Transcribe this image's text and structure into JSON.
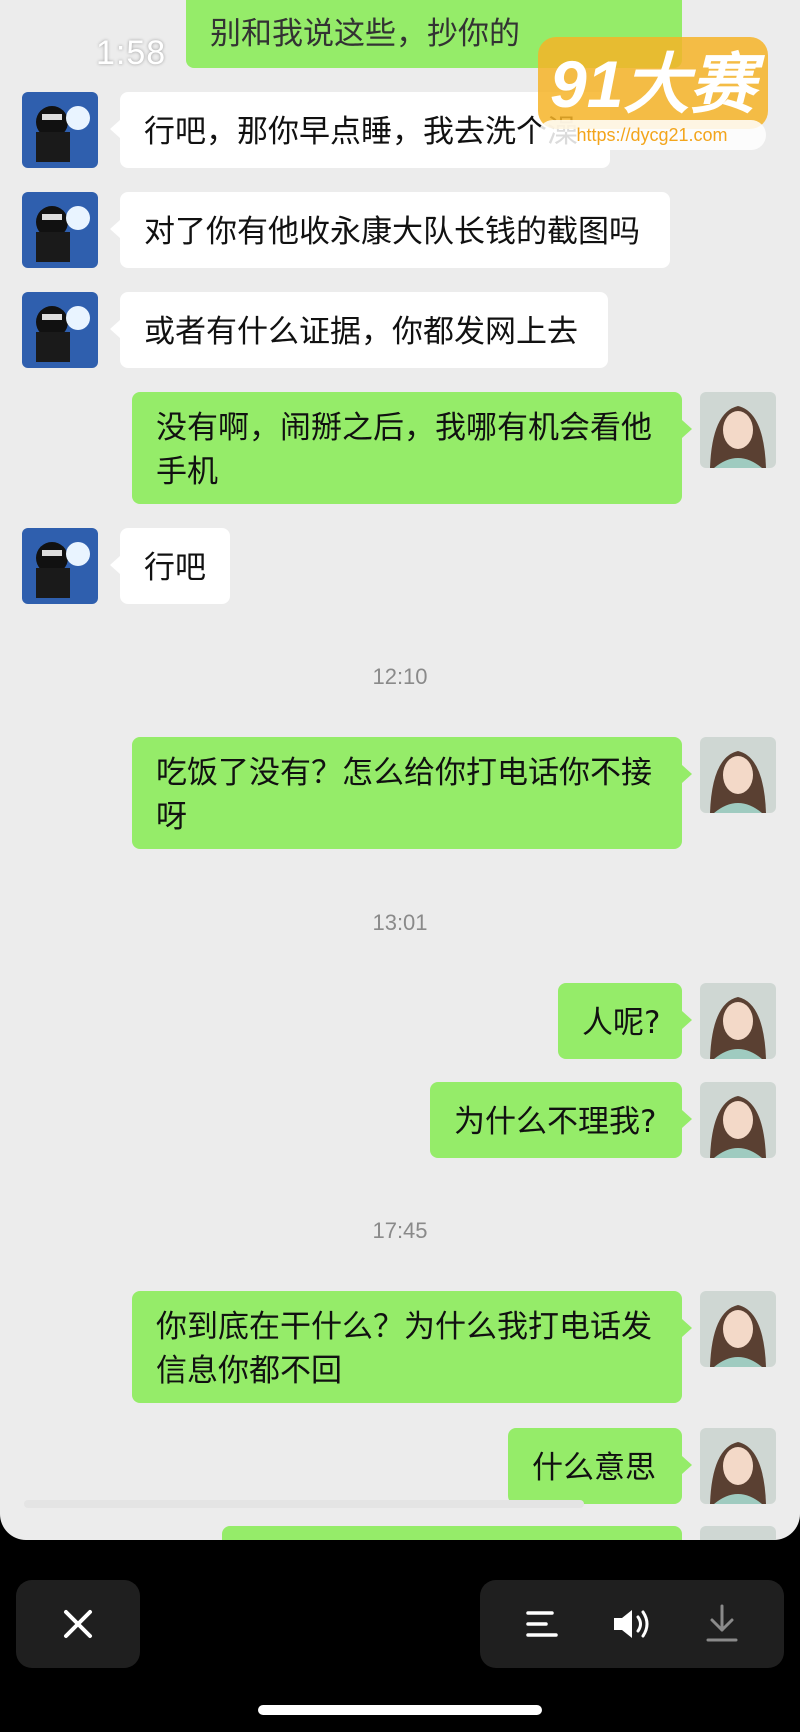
{
  "status": {
    "time": "1:58"
  },
  "watermark": {
    "text": "91大赛",
    "url": "https://dycg21.com"
  },
  "messages": {
    "top_partial": "别和我说这些，抄你的",
    "m1": "行吧，那你早点睡，我去洗个澡",
    "m2": "对了你有他收永康大队长钱的截图吗",
    "m3": "或者有什么证据，你都发网上去",
    "m4": "没有啊，闹掰之后，我哪有机会看他手机",
    "m5": "行吧",
    "ts1": "12:10",
    "m6": "吃饭了没有？怎么给你打电话你不接呀",
    "ts2": "13:01",
    "m7": "人呢?",
    "m8": "为什么不理我?",
    "ts3": "17:45",
    "m9": "你到底在干什么？为什么我打电话发信息你都不回",
    "m10": "什么意思"
  },
  "controls": {
    "close_icon": "close-icon",
    "menu_icon": "menu-icon",
    "volume_icon": "volume-icon",
    "download_icon": "download-icon"
  },
  "colors": {
    "outgoing": "#95ec69",
    "incoming": "#ffffff",
    "chat_bg": "#ececec"
  }
}
